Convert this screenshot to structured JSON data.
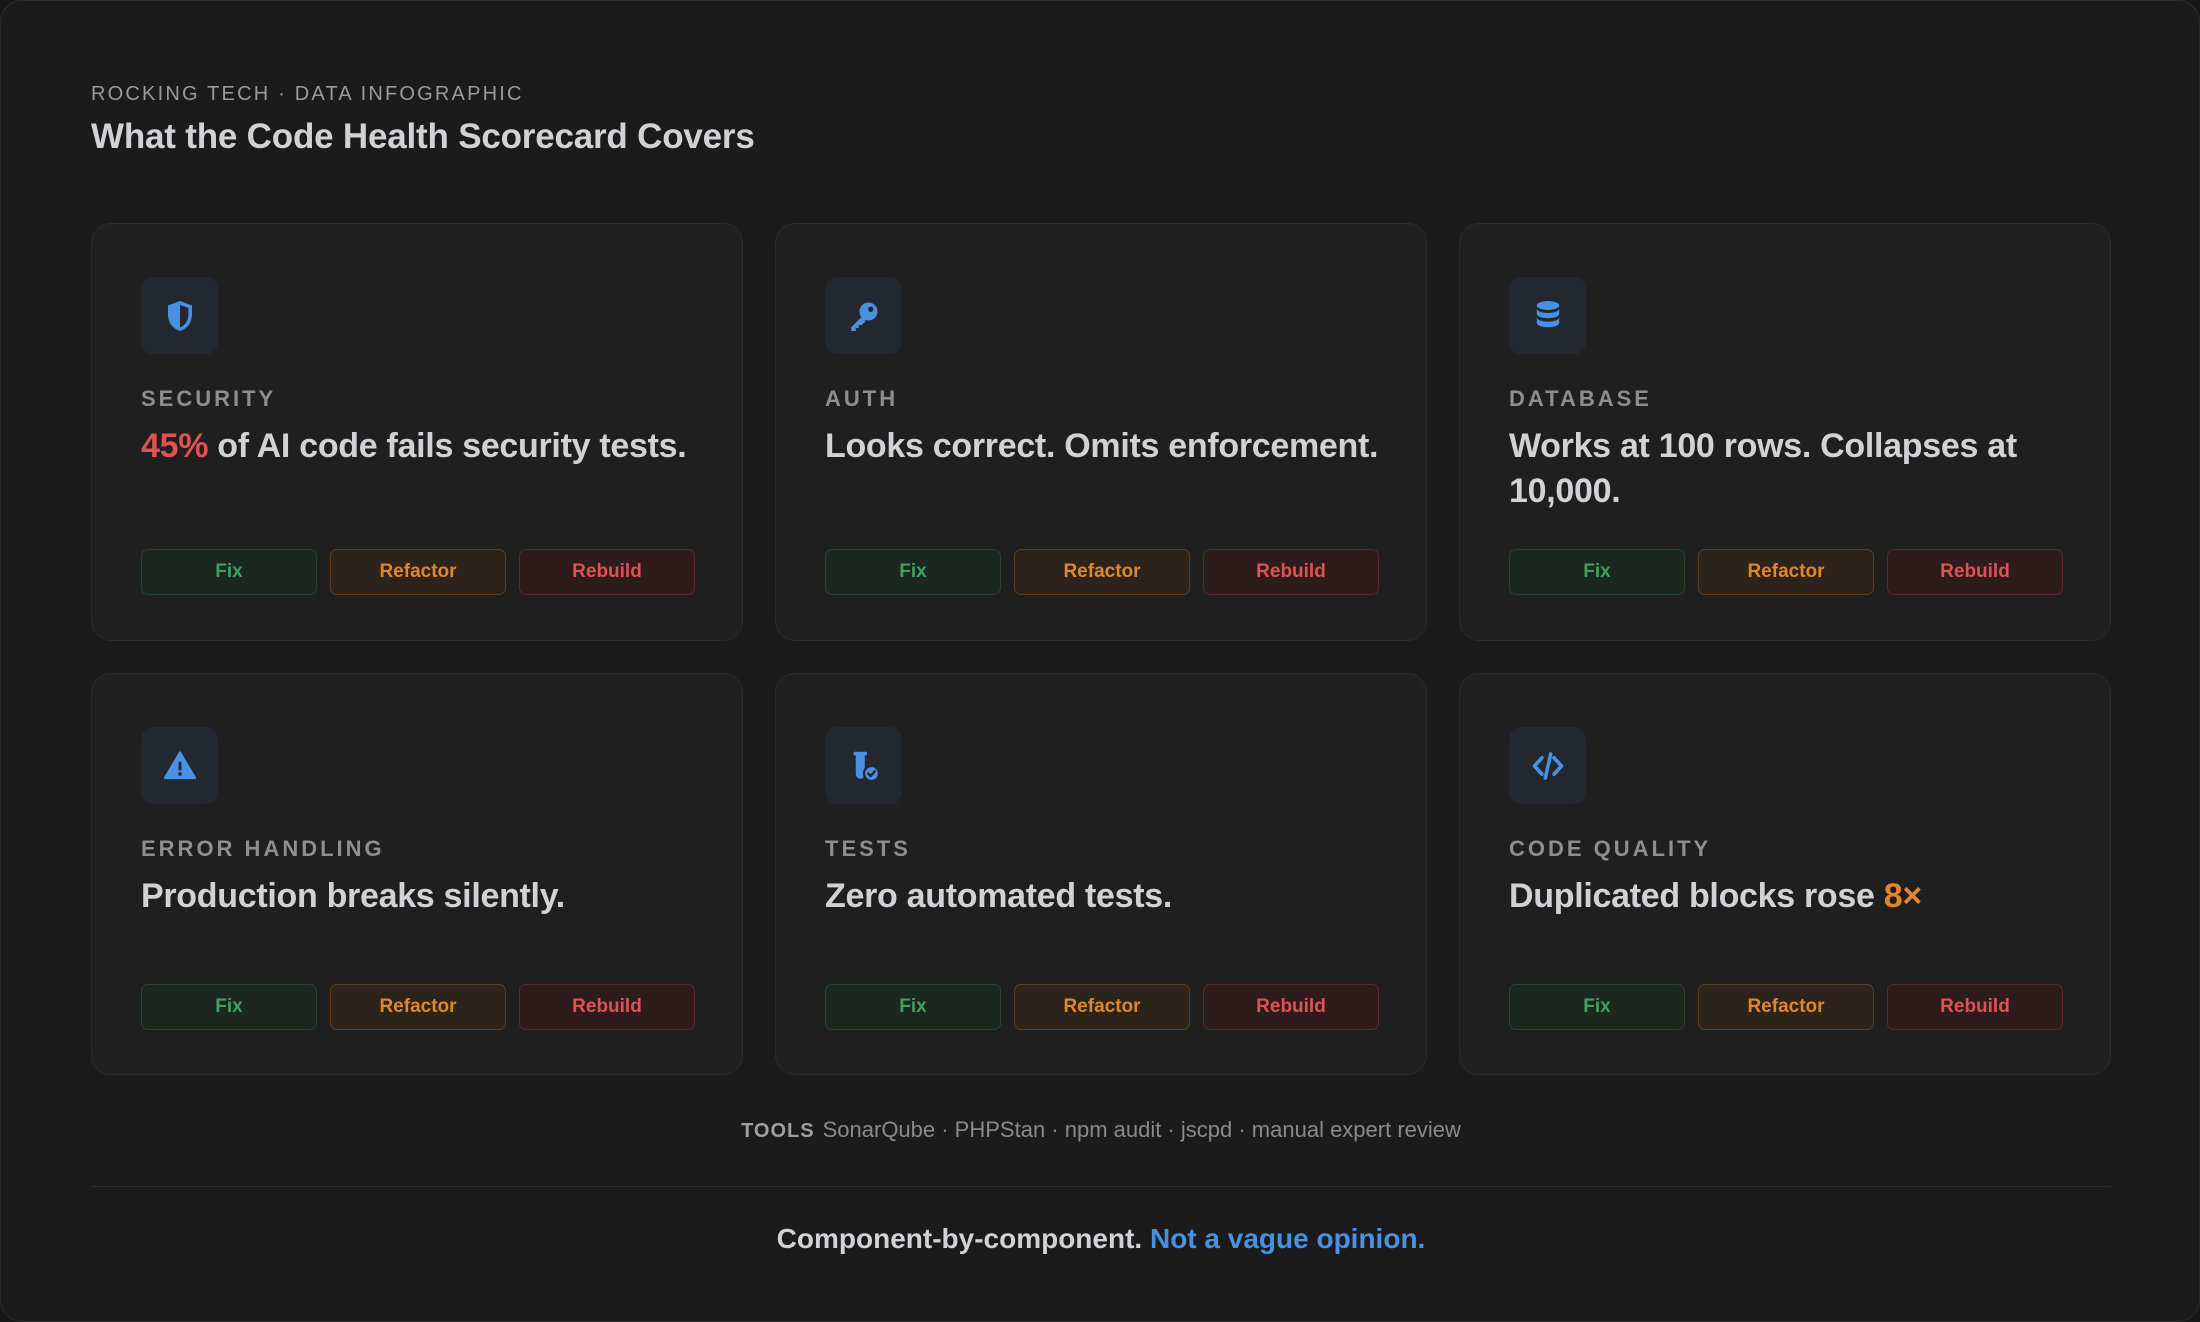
{
  "header": {
    "eyebrow": "ROCKING TECH · DATA INFOGRAPHIC",
    "title": "What the Code Health Scorecard Covers"
  },
  "colors": {
    "background": "#1b1b1b",
    "card": "#1f1f1f",
    "accent_blue": "#4a90e2",
    "fix_green": "#3ea35d",
    "refactor_orange": "#e0862d",
    "rebuild_red": "#e05252"
  },
  "cards": [
    {
      "icon": "shield-icon",
      "label": "SECURITY",
      "headline_highlight": "45%",
      "headline_text": " of AI code fails security tests.",
      "actions": [
        "Fix",
        "Refactor",
        "Rebuild"
      ]
    },
    {
      "icon": "key-icon",
      "label": "AUTH",
      "headline_text": "Looks correct. Omits enforcement.",
      "actions": [
        "Fix",
        "Refactor",
        "Rebuild"
      ]
    },
    {
      "icon": "database-icon",
      "label": "DATABASE",
      "headline_text": "Works at 100 rows. Collapses at 10,000.",
      "actions": [
        "Fix",
        "Refactor",
        "Rebuild"
      ]
    },
    {
      "icon": "warning-icon",
      "label": "ERROR HANDLING",
      "headline_text": "Production breaks silently.",
      "actions": [
        "Fix",
        "Refactor",
        "Rebuild"
      ]
    },
    {
      "icon": "test-tube-check-icon",
      "label": "TESTS",
      "headline_text": "Zero automated tests.",
      "actions": [
        "Fix",
        "Refactor",
        "Rebuild"
      ]
    },
    {
      "icon": "code-icon",
      "label": "CODE QUALITY",
      "headline_text": "Duplicated blocks rose ",
      "headline_highlight": "8×",
      "actions": [
        "Fix",
        "Refactor",
        "Rebuild"
      ]
    }
  ],
  "tools": {
    "label": "TOOLS",
    "list": "SonarQube · PHPStan · npm audit · jscpd · manual expert review"
  },
  "tagline": {
    "text": "Component-by-component.",
    "accent": "Not a vague opinion."
  }
}
